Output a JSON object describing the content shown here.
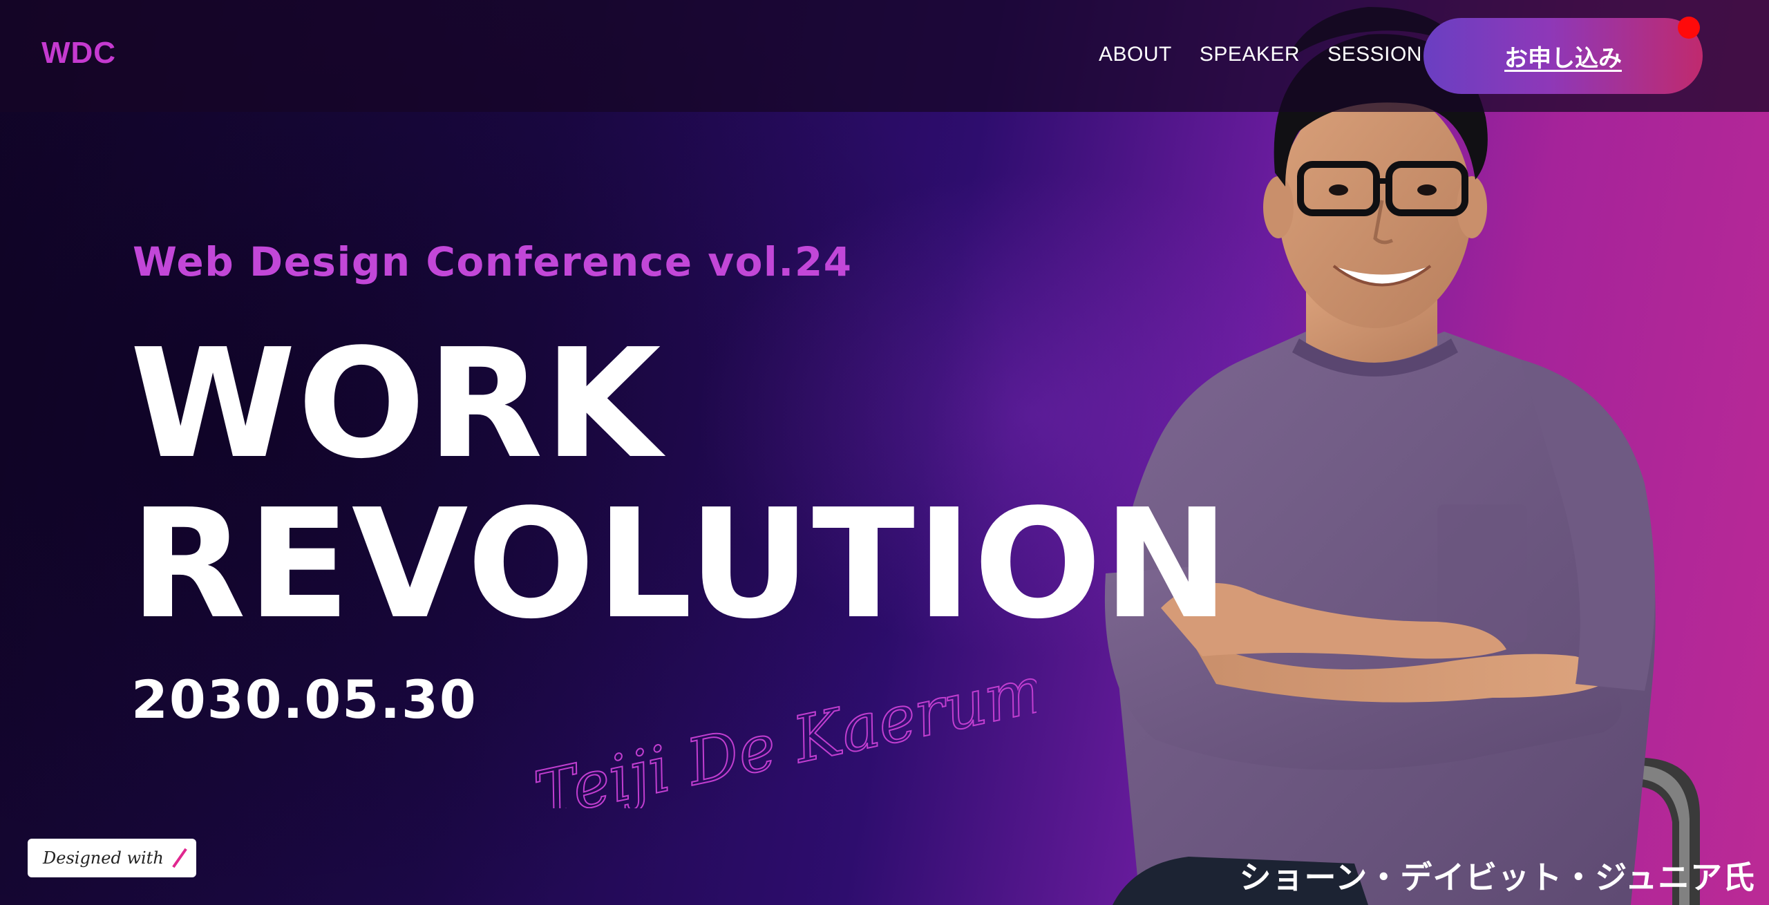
{
  "header": {
    "logo": "WDC",
    "nav": [
      {
        "label": "ABOUT"
      },
      {
        "label": "SPEAKER"
      },
      {
        "label": "SESSION"
      }
    ],
    "cta_label": "お申し込み"
  },
  "hero": {
    "subtitle": "Web Design Conference vol.24",
    "headline_line1": "WORK",
    "headline_line2": "REVOLUTION",
    "date": "2030.05.30",
    "signature": "Teiji De Kaerumon",
    "speaker_name": "ショーン・デイビット・ジュニア氏"
  },
  "badge": {
    "text": "Designed with"
  },
  "colors": {
    "accent": "#c53ad0",
    "subtitle": "#c247d8",
    "cta_start": "#6a3fc2",
    "cta_end": "#c02a6e",
    "notification": "#ff0a0a"
  }
}
